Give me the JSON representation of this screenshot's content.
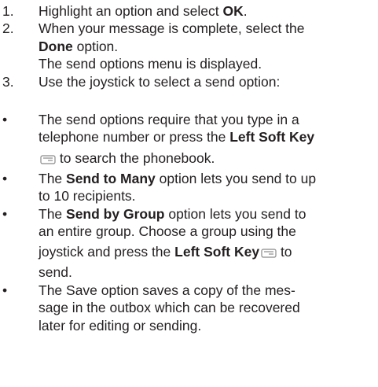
{
  "steps": [
    {
      "number": "1.",
      "text_before": "Highlight an option and select ",
      "bold": "OK",
      "text_after": "."
    },
    {
      "number": "2.",
      "line1": "When your message is complete, select the",
      "bold": "Done",
      "line2_after": " option.",
      "line3": "The send options menu is displayed."
    },
    {
      "number": "3.",
      "text": "Use the joystick to select a send option:"
    }
  ],
  "bullets": [
    {
      "marker": "•",
      "line1": "The send options require that you type in a",
      "line2_before": "telephone number or press the ",
      "line2_bold": "Left Soft Key",
      "icon": "left-soft-key-icon",
      "line3_after": " to search the phonebook."
    },
    {
      "marker": "•",
      "line1_before": "The ",
      "line1_bold": "Send to Many",
      "line1_after": " option lets you send to up",
      "line2": "to 10 recipients."
    },
    {
      "marker": "•",
      "line1_before": "The ",
      "line1_bold": "Send by Group",
      "line1_after": " option lets you send to",
      "line2": "an entire group. Choose a group using the",
      "line3_before": "joystick and press the ",
      "line3_bold": "Left Soft Key",
      "icon": "left-soft-key-icon",
      "line3_after": " to",
      "line4": "send."
    },
    {
      "marker": "•",
      "line1": "The Save option saves a copy of the mes-",
      "line2": "sage in the outbox which can be recovered",
      "line3": "later for editing or sending."
    }
  ],
  "colors": {
    "text": "#231f20",
    "icon": "#8a8a8a"
  }
}
